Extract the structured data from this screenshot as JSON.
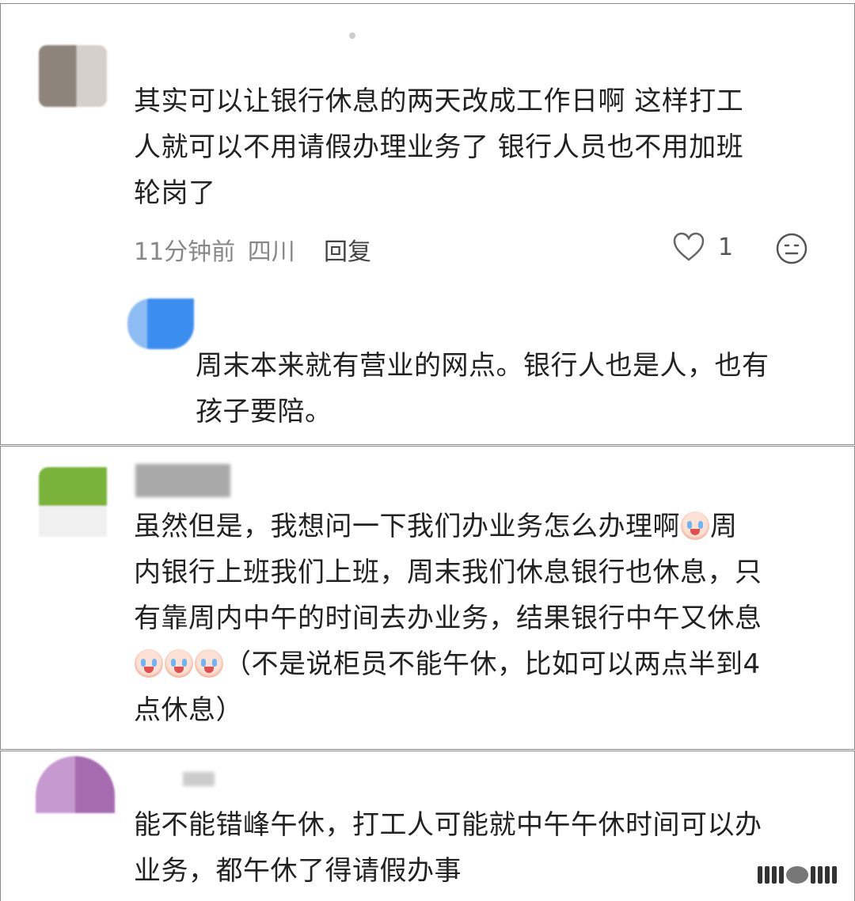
{
  "comments": [
    {
      "text_lines": [
        "其实可以让银行休息的两天改成工作日啊 这样打工",
        "人就可以不用请假办理业务了 银行人员也不用加班",
        "轮岗了"
      ],
      "time": "11分钟前",
      "location": "四川",
      "reply_label": "回复",
      "like_count": "1",
      "reply": {
        "text_lines": [
          "周末本来就有营业的网点。银行人也是人，也有",
          "孩子要陪。"
        ]
      }
    },
    {
      "text_lines": [
        "虽然但是，我想问一下我们办业务怎么办理啊",
        "周",
        "内银行上班我们上班，周末我们休息银行也休息，只",
        "有靠周内中午的时间去办业务，结果银行中午又休息",
        "（不是说柜员不能午休，比如可以两点半到4",
        "点休息）"
      ]
    },
    {
      "text_lines": [
        "能不能错峰午休，打工人可能就中午午休时间可以办",
        "业务，都午休了得请假办事"
      ]
    }
  ],
  "icons": {
    "like": "heart-outline-icon",
    "emoji": "crying-face-emoji-icon",
    "react": "smile-face-icon"
  },
  "colors": {
    "text": "#222222",
    "meta": "#888888",
    "border": "#8a8a8a"
  }
}
